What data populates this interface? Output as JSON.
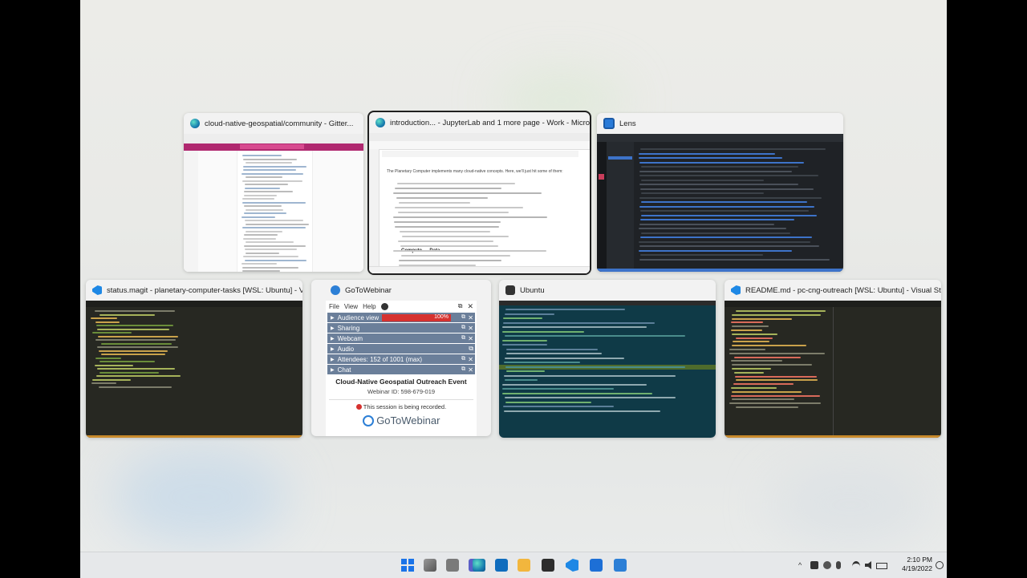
{
  "windows": {
    "gitter": {
      "title": "cloud-native-geospatial/community - Gitter..."
    },
    "jupyter": {
      "title": "introduction... - JupyterLab and 1 more page - Work - Micro..."
    },
    "lens": {
      "title": "Lens"
    },
    "magit": {
      "title": "status.magit - planetary-computer-tasks [WSL: Ubuntu] - Vi..."
    },
    "gotowebinar": {
      "title": "GoToWebinar",
      "menu": [
        "File",
        "View",
        "Help"
      ],
      "rows": [
        {
          "label": "Audience view",
          "value": "100%"
        },
        {
          "label": "Sharing"
        },
        {
          "label": "Webcam"
        },
        {
          "label": "Audio"
        },
        {
          "label": "Attendees: 152 of 1001 (max)"
        },
        {
          "label": "Chat"
        }
      ],
      "event_title": "Cloud-Native Geospatial Outreach Event",
      "webinar_id": "Webinar ID: 598-679-019",
      "recording": "This session is being recorded.",
      "logo": "GoToWebinar"
    },
    "ubuntu": {
      "title": "Ubuntu"
    },
    "readme": {
      "title": "README.md - pc-cng-outreach [WSL: Ubuntu] - Visual Stud..."
    }
  },
  "jupyter_notebook": {
    "heading": "Compute → Data",
    "intro": "The Planetary Computer implements many cloud-native concepts. Here, we'll just hit some of them:"
  },
  "taskbar": {
    "time": "2:10 PM",
    "date": "4/19/2022"
  },
  "colors": {
    "accent": "#1e88e5",
    "record": "#d6322f",
    "gtw_row": "#6b7f9a",
    "dark_editor": "#252526"
  }
}
